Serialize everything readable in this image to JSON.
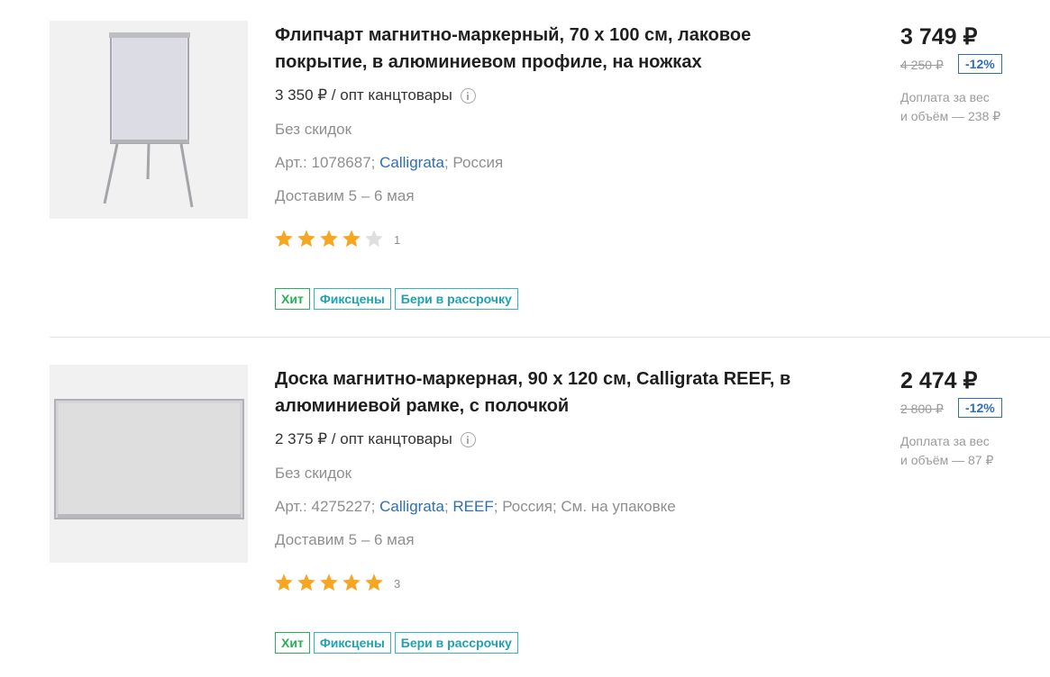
{
  "products": [
    {
      "title": "Флипчарт магнитно-маркерный, 70 х 100 см, лаковое покрытие, в алюминиевом профиле, на ножках",
      "opt_price": "3 350 ₽ / опт канцтовары",
      "no_discount": "Без скидок",
      "art_prefix": "Арт.: 1078687;",
      "brand": "Calligrata",
      "art_rest": "; Россия",
      "delivery": "Доставим 5 – 6 мая",
      "rating": 4,
      "rating_max": 5,
      "rating_count": "1",
      "badges": [
        "Хит",
        "Фиксцены",
        "Бери в рассрочку"
      ],
      "price": "3 749 ₽",
      "old_price": "4 250 ₽",
      "discount": "-12%",
      "extra_line1": "Доплата за вес",
      "extra_line2": "и объём — 238 ₽",
      "image_icon": "flipchart-image"
    },
    {
      "title": "Доска магнитно-маркерная, 90 х 120 см, Calligrata REEF, в алюминиевой рамке, с полочкой",
      "opt_price": "2 375 ₽ / опт канцтовары",
      "no_discount": "Без скидок",
      "art_prefix": "Арт.: 4275227;",
      "brand": "Calligrata",
      "brand2": "REEF",
      "art_rest": "; Россия; См. на упаковке",
      "delivery": "Доставим 5 – 6 мая",
      "rating": 5,
      "rating_max": 5,
      "rating_count": "3",
      "badges": [
        "Хит",
        "Фиксцены",
        "Бери в рассрочку"
      ],
      "price": "2 474 ₽",
      "old_price": "2 800 ₽",
      "discount": "-12%",
      "extra_line1": "Доплата за вес",
      "extra_line2": "и объём — 87 ₽",
      "image_icon": "whiteboard-image"
    }
  ],
  "colors": {
    "star_filled": "#f5a623",
    "star_empty": "#dedede",
    "link": "#2f6fad",
    "badge_hit": "#26b058",
    "badge_teal": "#1fa2b0",
    "discount": "#2f6fb0"
  }
}
